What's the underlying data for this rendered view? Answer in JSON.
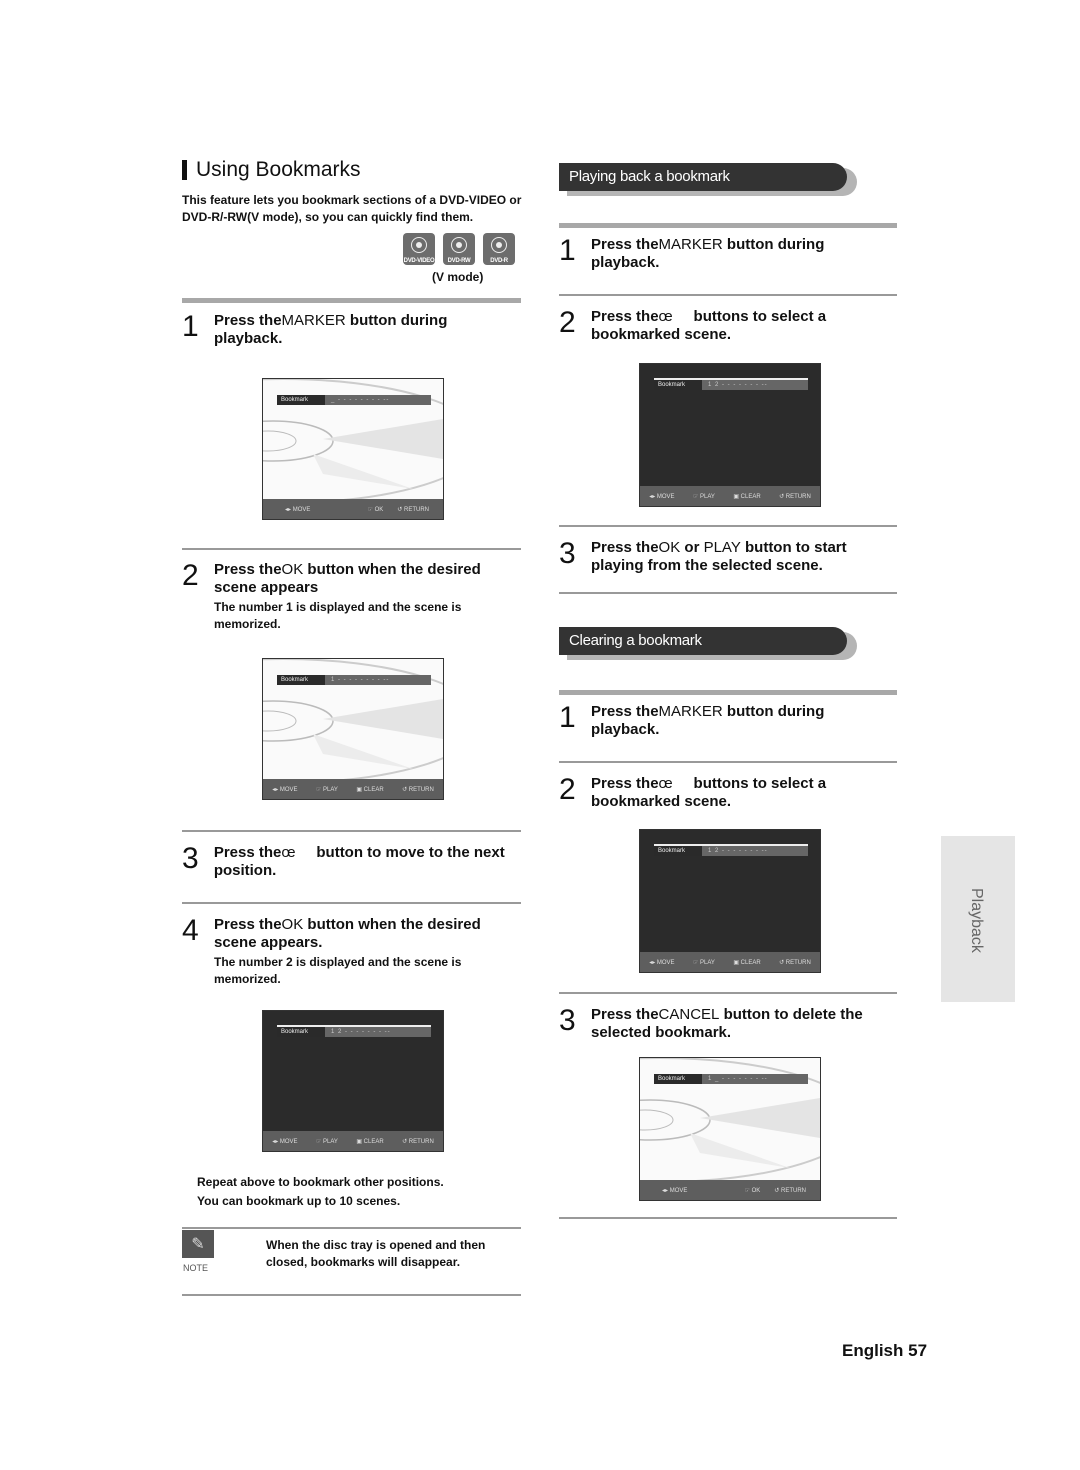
{
  "left": {
    "title": "Using Bookmarks",
    "intro": "This feature lets you bookmark sections of a DVD-VIDEO or DVD-R/-RW(V mode), so you can quickly find them.",
    "disc_icons": [
      {
        "icon": "disc-icon",
        "label": "DVD-VIDEO"
      },
      {
        "icon": "disc-icon",
        "label": "DVD-RW"
      },
      {
        "icon": "disc-icon",
        "label": "DVD-R"
      }
    ],
    "vmode": "(V mode)",
    "steps": [
      {
        "num": "1",
        "pre": "Press the",
        "key": "MARKER",
        "post": " button during playback."
      },
      {
        "num": "2",
        "pre": "Press the",
        "key": "OK",
        "post": " button when the desired scene appears",
        "sub": "The number 1 is displayed and the scene is memorized."
      },
      {
        "num": "3",
        "pre": "Press the",
        "key": "œ",
        "post": "     button to move to the next position."
      },
      {
        "num": "4",
        "pre": "Press the",
        "key": "OK",
        "post": " button when the desired scene appears.",
        "sub": "The number 2 is displayed and the scene is memorized."
      }
    ],
    "repeat_line1": "Repeat above to bookmark other positions.",
    "repeat_line2": "You can bookmark up to 10 scenes.",
    "note_icon": "pencil-icon",
    "note_label": "NOTE",
    "note_text": "When the disc tray is opened and then closed, bookmarks will disappear."
  },
  "right": {
    "section1": "Playing back a bookmark",
    "play_steps": [
      {
        "num": "1",
        "pre": "Press the",
        "key": "MARKER",
        "post": " button during playback."
      },
      {
        "num": "2",
        "pre": "Press the",
        "key": "œ",
        "post": "     buttons to select a bookmarked scene."
      },
      {
        "num": "3",
        "pre": "Press the",
        "key": "OK",
        "mid": " or ",
        "key2": "PLAY",
        "post": " button to start playing from the selected scene."
      }
    ],
    "section2": "Clearing a bookmark",
    "clear_steps": [
      {
        "num": "1",
        "pre": "Press the",
        "key": "MARKER",
        "post": " button during playback."
      },
      {
        "num": "2",
        "pre": "Press the",
        "key": "œ",
        "post": "     buttons to select a bookmarked scene."
      },
      {
        "num": "3",
        "pre": "Press the",
        "key": "CANCEL",
        "post": " button to delete the selected bookmark."
      }
    ]
  },
  "osd": {
    "bookmark_label": "Bookmark",
    "slots_empty": "_ - - - - - - - - --",
    "slots_one": "1 - - - - - - - - --",
    "slots_two": "1 2 - - - - - - - --",
    "slots_one_next": "1 _ - - - - - - - --",
    "move": "◂▸ MOVE",
    "ok": "☞ OK",
    "play": "☞ PLAY",
    "clear": "▣ CLEAR",
    "return": "↺ RETURN"
  },
  "side_tab": "Playback",
  "footer": {
    "language": "English",
    "page": "57"
  }
}
